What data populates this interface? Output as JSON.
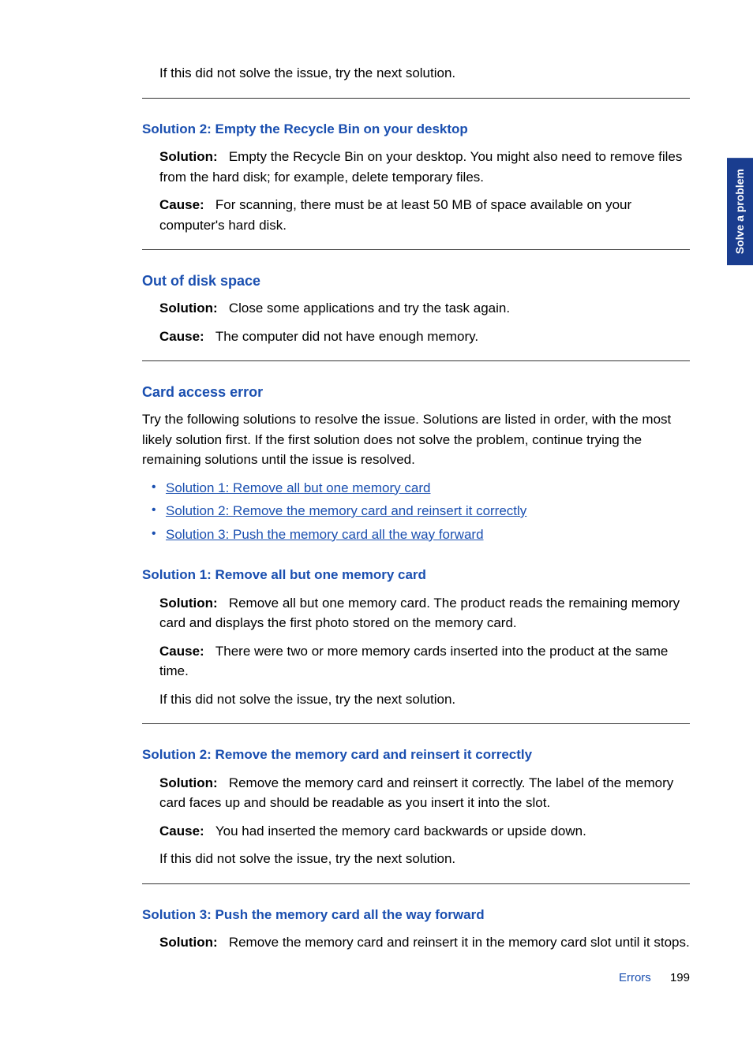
{
  "side_tab": "Solve a problem",
  "intro_try_next": "If this did not solve the issue, try the next solution.",
  "sol2_recycle": {
    "heading": "Solution 2: Empty the Recycle Bin on your desktop",
    "solution_label": "Solution:",
    "solution_text": "Empty the Recycle Bin on your desktop. You might also need to remove files from the hard disk; for example, delete temporary files.",
    "cause_label": "Cause:",
    "cause_text": "For scanning, there must be at least 50 MB of space available on your computer's hard disk."
  },
  "out_of_disk": {
    "heading": "Out of disk space",
    "solution_label": "Solution:",
    "solution_text": "Close some applications and try the task again.",
    "cause_label": "Cause:",
    "cause_text": "The computer did not have enough memory."
  },
  "card_access": {
    "heading": "Card access error",
    "intro": "Try the following solutions to resolve the issue. Solutions are listed in order, with the most likely solution first. If the first solution does not solve the problem, continue trying the remaining solutions until the issue is resolved.",
    "links": [
      "Solution 1: Remove all but one memory card",
      "Solution 2: Remove the memory card and reinsert it correctly",
      "Solution 3: Push the memory card all the way forward"
    ]
  },
  "card_sol1": {
    "heading": "Solution 1: Remove all but one memory card",
    "solution_label": "Solution:",
    "solution_text": "Remove all but one memory card. The product reads the remaining memory card and displays the first photo stored on the memory card.",
    "cause_label": "Cause:",
    "cause_text": "There were two or more memory cards inserted into the product at the same time.",
    "try_next": "If this did not solve the issue, try the next solution."
  },
  "card_sol2": {
    "heading": "Solution 2: Remove the memory card and reinsert it correctly",
    "solution_label": "Solution:",
    "solution_text": "Remove the memory card and reinsert it correctly. The label of the memory card faces up and should be readable as you insert it into the slot.",
    "cause_label": "Cause:",
    "cause_text": "You had inserted the memory card backwards or upside down.",
    "try_next": "If this did not solve the issue, try the next solution."
  },
  "card_sol3": {
    "heading": "Solution 3: Push the memory card all the way forward",
    "solution_label": "Solution:",
    "solution_text": "Remove the memory card and reinsert it in the memory card slot until it stops."
  },
  "footer": {
    "label": "Errors",
    "page": "199"
  }
}
